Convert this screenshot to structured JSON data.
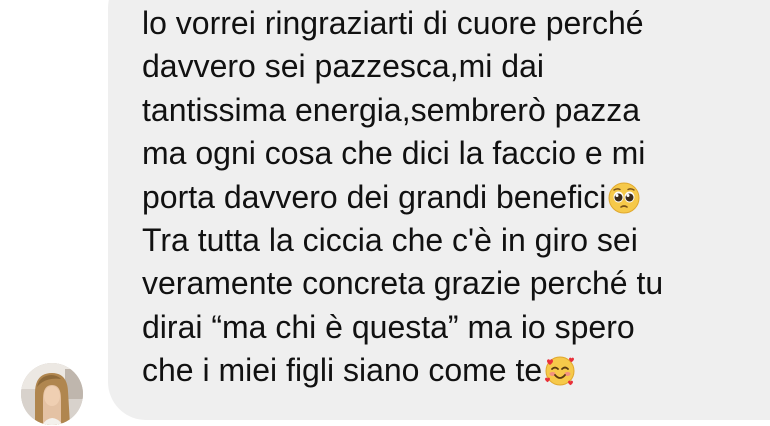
{
  "message": {
    "lines": [
      "lo vorrei ringraziarti di cuore perché",
      "davvero sei pazzesca,mi dai",
      "tantissima energia,sembrerò pazza",
      "ma ogni cosa che dici la faccio e mi",
      "porta davvero dei grandi benefici",
      "Tra tutta la ciccia che c'è in giro sei",
      "veramente concreta grazie perché tu",
      "dirai “ma chi è questa” ma io spero",
      "che i miei figli siano come te"
    ],
    "emojis": {
      "line5": "pleading-face-icon",
      "line9": "smiling-face-with-hearts-icon"
    }
  },
  "sender": {
    "avatar": "avatar"
  },
  "colors": {
    "bubble": "#efefef",
    "text": "#111111",
    "background": "#ffffff"
  }
}
